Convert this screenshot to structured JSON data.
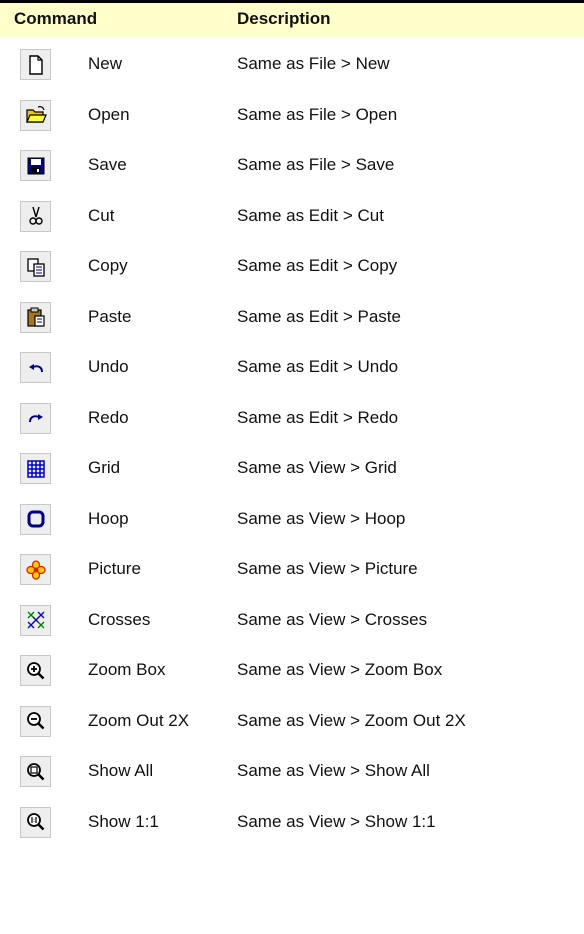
{
  "header": {
    "command_label": "Command",
    "description_label": "Description"
  },
  "rows": [
    {
      "icon": "new-document-icon",
      "name": "New",
      "description": "Same as File > New"
    },
    {
      "icon": "open-folder-icon",
      "name": "Open",
      "description": "Same as File > Open"
    },
    {
      "icon": "save-disk-icon",
      "name": "Save",
      "description": "Same as File > Save"
    },
    {
      "icon": "scissors-icon",
      "name": "Cut",
      "description": "Same as Edit > Cut"
    },
    {
      "icon": "copy-icon",
      "name": "Copy",
      "description": "Same as Edit > Copy"
    },
    {
      "icon": "paste-clipboard-icon",
      "name": "Paste",
      "description": "Same as Edit > Paste"
    },
    {
      "icon": "undo-arrow-icon",
      "name": "Undo",
      "description": "Same as Edit > Undo"
    },
    {
      "icon": "redo-arrow-icon",
      "name": "Redo",
      "description": "Same as Edit > Redo"
    },
    {
      "icon": "grid-icon",
      "name": "Grid",
      "description": "Same as View > Grid"
    },
    {
      "icon": "hoop-icon",
      "name": "Hoop",
      "description": "Same as View > Hoop"
    },
    {
      "icon": "picture-flower-icon",
      "name": "Picture",
      "description": "Same as View > Picture"
    },
    {
      "icon": "crosses-stitch-icon",
      "name": "Crosses",
      "description": "Same as View > Crosses"
    },
    {
      "icon": "zoom-in-icon",
      "name": "Zoom Box",
      "description": "Same as View > Zoom Box"
    },
    {
      "icon": "zoom-out-icon",
      "name": "Zoom Out 2X",
      "description": "Same as View > Zoom Out 2X"
    },
    {
      "icon": "show-all-icon",
      "name": "Show All",
      "description": "Same as View > Show All"
    },
    {
      "icon": "show-1-1-icon",
      "name": "Show 1:1",
      "description": "Same as View > Show 1:1"
    }
  ],
  "colors": {
    "header_bg": "#ffffcc",
    "icon_bg": "#eeeeee",
    "accent_blue": "#0000a0"
  }
}
